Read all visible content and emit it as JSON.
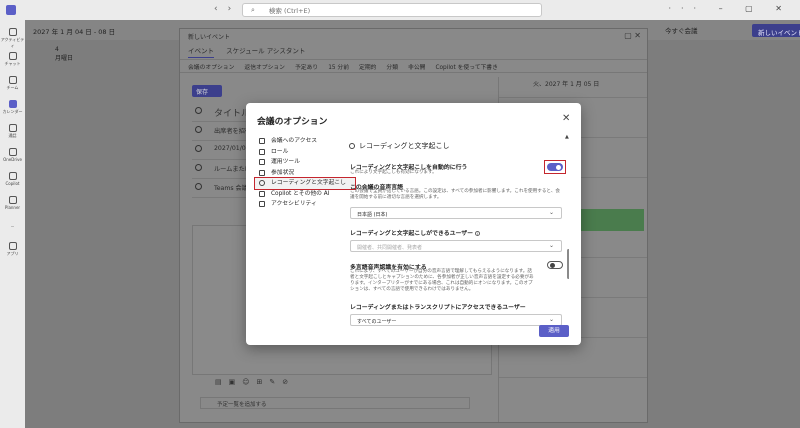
{
  "app": {
    "search_placeholder": "検索 (Ctrl+E)",
    "rail": [
      "アクティビティ",
      "チャット",
      "チーム",
      "カレンダー",
      "通話",
      "OneDrive",
      "Copilot",
      "Planner",
      "アプリ"
    ],
    "calendar_range": "2027 年 1 月 04 日 - 08 日",
    "today_label": "今すぐ会議",
    "new_event_label": "新しいイベント",
    "day_label": "4\n月曜日"
  },
  "event_window": {
    "title": "新しいイベント",
    "tabs": [
      "イベント",
      "スケジュール アシスタント"
    ],
    "toolbar": [
      "会議のオプション",
      "返信オプション",
      "予定あり",
      "15 分前",
      "定期的",
      "分類",
      "非公開",
      "Copilot を使って下書き"
    ],
    "save_label": "保存",
    "title_placeholder": "タイトルを追加",
    "attendees_placeholder": "出席者を招待",
    "date_value": "2027/01/05",
    "location_placeholder": "ルームまたは場所を追加",
    "teams_label": "Teams 会議",
    "add_agenda": "予定一覧を追加する",
    "side_date": "火、2027 年 1 月 05 日"
  },
  "dialog": {
    "title": "会議のオプション",
    "nav": [
      {
        "label": "会議へのアクセス",
        "icon": "access-icon"
      },
      {
        "label": "ロール",
        "icon": "roles-icon"
      },
      {
        "label": "運用ツール",
        "icon": "tools-icon"
      },
      {
        "label": "参加状況",
        "icon": "engagement-icon"
      },
      {
        "label": "レコーディングと文字起こし",
        "icon": "recording-icon",
        "selected": true
      },
      {
        "label": "Copilot とその他の AI",
        "icon": "copilot-icon"
      },
      {
        "label": "アクセシビリティ",
        "icon": "accessibility-icon"
      }
    ],
    "section_title": "レコーディングと文字起こし",
    "auto_record": {
      "label": "レコーディングと文字起こしを自動的に行う",
      "desc": "これにより文字起こしも有効になります。",
      "enabled": true
    },
    "spoken_language": {
      "label": "この会議の音声言語",
      "desc": "この会議で全員が話している言語。この設定は、すべての参加者に影響します。これを使用すると、会議を開始する前に適切な言語を選択します。",
      "value": "日本語 (日本)"
    },
    "who_can_record": {
      "label": "レコーディングと文字起こしができるユーザー",
      "placeholder": "開催者、共同開催者、発表者"
    },
    "multilingual": {
      "label": "多言語音声認識を有効にする",
      "desc": "これにより、すべてのユーザーが自分の音声言語で理解してもらえるようになります。話者と文字起こしとキャプションのために、各参加者が正しい音声言語を設定する必要があります。インタープリターがすでにある場合、これは自動的にオンになります。このオプションは、すべての言語で使用できるわけではありません。",
      "enabled": false
    },
    "who_can_access": {
      "label": "レコーディングまたはトランスクリプトにアクセスできるユーザー",
      "value": "すべてのユーザー"
    },
    "apply_label": "適用"
  },
  "colors": {
    "accent": "#5b5fc7",
    "highlight": "#c4262e"
  }
}
